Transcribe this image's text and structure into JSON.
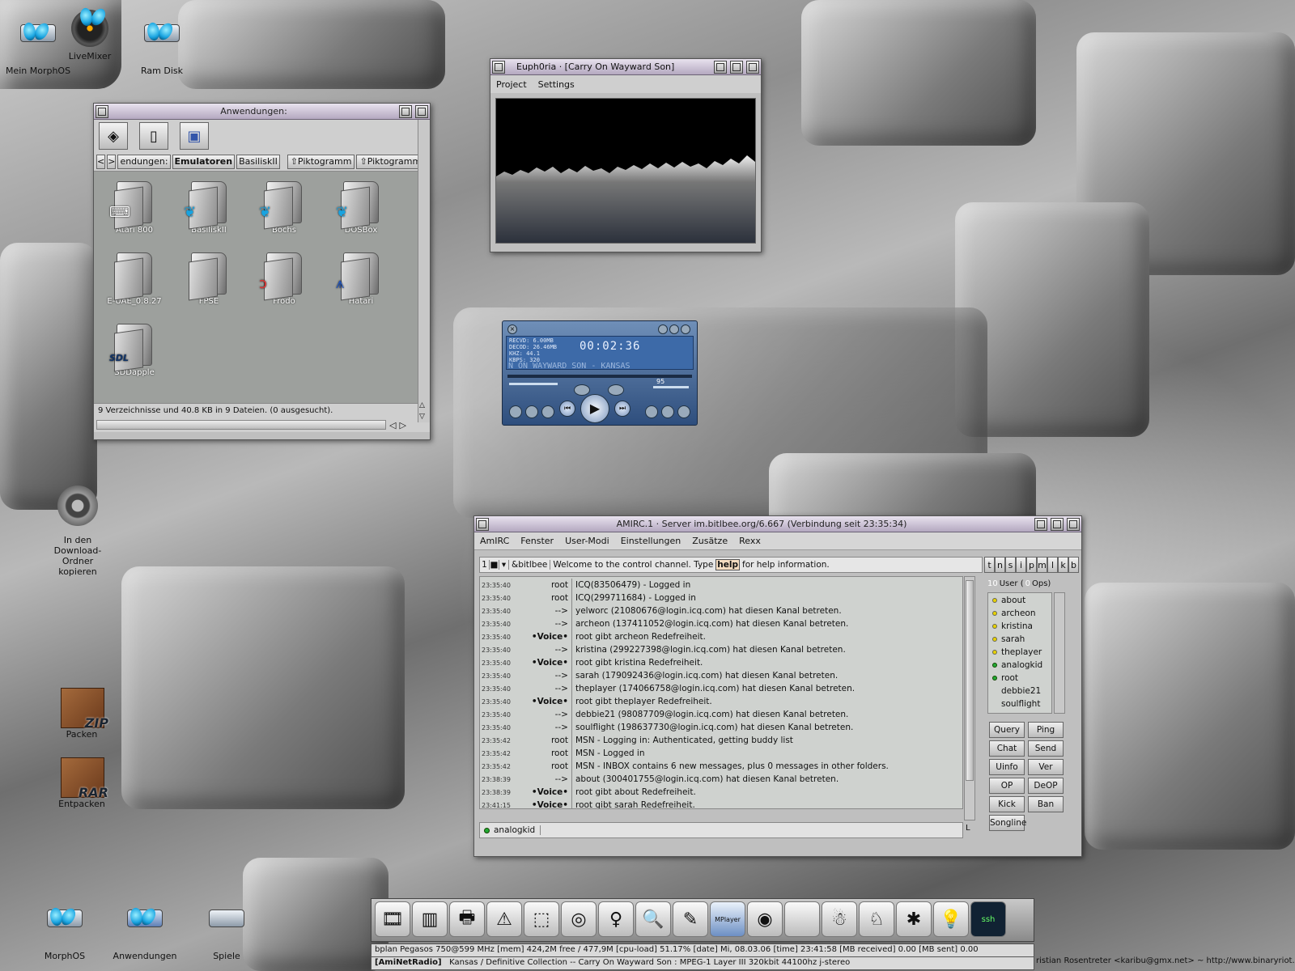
{
  "desktop_icons": [
    {
      "label": "Mein MorphOS"
    },
    {
      "label": "LiveMixer"
    },
    {
      "label": "Ram Disk"
    },
    {
      "label": "In den Download-Ordner kopieren"
    },
    {
      "label": "Packen",
      "badge": "ZIP"
    },
    {
      "label": "Entpacken",
      "badge": "RAR"
    },
    {
      "label": "MorphOS"
    },
    {
      "label": "Anwendungen"
    },
    {
      "label": "Spiele"
    }
  ],
  "anwendungen": {
    "title": "Anwendungen:",
    "path": [
      "endungen:",
      "Emulatoren",
      "BasiliskII"
    ],
    "view_btn1": "Piktogramm",
    "view_btn2": "Piktogramme",
    "folders": [
      "Atari 800",
      "BasiliskII",
      "Bochs",
      "DOSBox",
      "E-UAE_0.8.27",
      "FPSE",
      "Frodo",
      "Hatari",
      "SDDapple"
    ],
    "status": "9 Verzeichnisse und 40.8 KB in 9 Dateien. (0 ausgesucht)."
  },
  "euphoria": {
    "title": "Euph0ria · [Carry On Wayward Son]",
    "menu": [
      "Project",
      "Settings"
    ]
  },
  "player": {
    "lines": [
      "RECVD: 6.00MB",
      "DECOD: 26.46MB",
      "KHZ: 44.1",
      "KBPS: 320"
    ],
    "time": "00:02:36",
    "scroller": "N ON WAYWARD SON - KANSAS",
    "volume": "95"
  },
  "amirc": {
    "title": "AMIRC.1 · Server im.bitlbee.org/6.667 (Verbindung seit 23:35:34)",
    "menu": [
      "AmIRC",
      "Fenster",
      "User-Modi",
      "Einstellungen",
      "Zusätze",
      "Rexx"
    ],
    "channel_num": "1",
    "channel": "&bitlbee",
    "topic_pre": "Welcome to the control channel. Type",
    "topic_help": "help",
    "topic_post": "for help information.",
    "mode_btns": [
      "t",
      "n",
      "s",
      "i",
      "p",
      "m",
      "l",
      "k",
      "b"
    ],
    "users_count": "10",
    "users_label": "User (",
    "ops_count": "0",
    "ops_label": "Ops)",
    "messages": [
      {
        "ts": "23:35:40",
        "nick": "root",
        "msg": "ICQ(83506479) - Logged in"
      },
      {
        "ts": "23:35:40",
        "nick": "root",
        "msg": "ICQ(299711684) - Logged in"
      },
      {
        "ts": "23:35:40",
        "nick": "-->",
        "msg": "yelworc (21080676@login.icq.com) hat diesen Kanal betreten."
      },
      {
        "ts": "23:35:40",
        "nick": "-->",
        "msg": "archeon (137411052@login.icq.com) hat diesen Kanal betreten."
      },
      {
        "ts": "23:35:40",
        "nick": "•Voice•",
        "msg": "root gibt archeon Redefreiheit."
      },
      {
        "ts": "23:35:40",
        "nick": "-->",
        "msg": "kristina (299227398@login.icq.com) hat diesen Kanal betreten."
      },
      {
        "ts": "23:35:40",
        "nick": "•Voice•",
        "msg": "root gibt kristina Redefreiheit."
      },
      {
        "ts": "23:35:40",
        "nick": "-->",
        "msg": "sarah (179092436@login.icq.com) hat diesen Kanal betreten."
      },
      {
        "ts": "23:35:40",
        "nick": "-->",
        "msg": "theplayer (174066758@login.icq.com) hat diesen Kanal betreten."
      },
      {
        "ts": "23:35:40",
        "nick": "•Voice•",
        "msg": "root gibt theplayer Redefreiheit."
      },
      {
        "ts": "23:35:40",
        "nick": "-->",
        "msg": "debbie21 (98087709@login.icq.com) hat diesen Kanal betreten."
      },
      {
        "ts": "23:35:40",
        "nick": "-->",
        "msg": "soulflight (198637730@login.icq.com) hat diesen Kanal betreten."
      },
      {
        "ts": "23:35:42",
        "nick": "root",
        "msg": "MSN - Logging in: Authenticated, getting buddy list"
      },
      {
        "ts": "23:35:42",
        "nick": "root",
        "msg": "MSN - Logged in"
      },
      {
        "ts": "23:35:42",
        "nick": "root",
        "msg": "MSN - INBOX contains 6 new messages, plus 0 messages in other folders."
      },
      {
        "ts": "23:38:39",
        "nick": "-->",
        "msg": "about (300401755@login.icq.com) hat diesen Kanal betreten."
      },
      {
        "ts": "23:38:39",
        "nick": "•Voice•",
        "msg": "root gibt about Redefreiheit."
      },
      {
        "ts": "23:41:15",
        "nick": "•Voice•",
        "msg": "root gibt sarah Redefreiheit."
      }
    ],
    "users": [
      {
        "name": "about",
        "status": "yellow"
      },
      {
        "name": "archeon",
        "status": "yellow"
      },
      {
        "name": "kristina",
        "status": "yellow"
      },
      {
        "name": "sarah",
        "status": "yellow"
      },
      {
        "name": "theplayer",
        "status": "yellow"
      },
      {
        "name": "analogkid",
        "status": "green"
      },
      {
        "name": "root",
        "status": "green"
      },
      {
        "name": "debbie21",
        "status": "none"
      },
      {
        "name": "soulflight",
        "status": "none"
      }
    ],
    "buttons": [
      "Query",
      "Ping",
      "Chat",
      "Send",
      "Uinfo",
      "Ver",
      "OP",
      "DeOP",
      "Kick",
      "Ban",
      "Songline"
    ],
    "input_nick": "analogkid",
    "input_end": "L"
  },
  "statusbar": {
    "line1": "bplan Pegasos 750@599 MHz [mem] 424,2M free / 477,9M [cpu-load] 51.17% [date] Mi, 08.03.06 [time] 23:41:58 [MB received] 0.00 [MB sent] 0.00",
    "line2_label": "[AmiNetRadio]",
    "line2": "Kansas / Definitive Collection -- Carry On Wayward Son : MPEG-1 Layer III 320kbit 44100hz j-stereo",
    "credit": "ristian Rosentreter <karibu@gmx.net> ~ http://www.binaryriot.com"
  },
  "dock_icons": [
    "camera-reel-icon",
    "monitor-icon",
    "printer-icon",
    "warning-sign-icon",
    "cube-icon",
    "rings-icon",
    "figure-icon",
    "magnifier-icon",
    "pen-icon",
    "mplayer-icon",
    "globe-icon",
    "apple-icon",
    "voodoo-icon",
    "donkey-icon",
    "spider-icon",
    "bulb-icon",
    "ssh-icon"
  ],
  "dock_labels": {
    "mplayer": "MPlayer",
    "ssh": "ssh"
  }
}
